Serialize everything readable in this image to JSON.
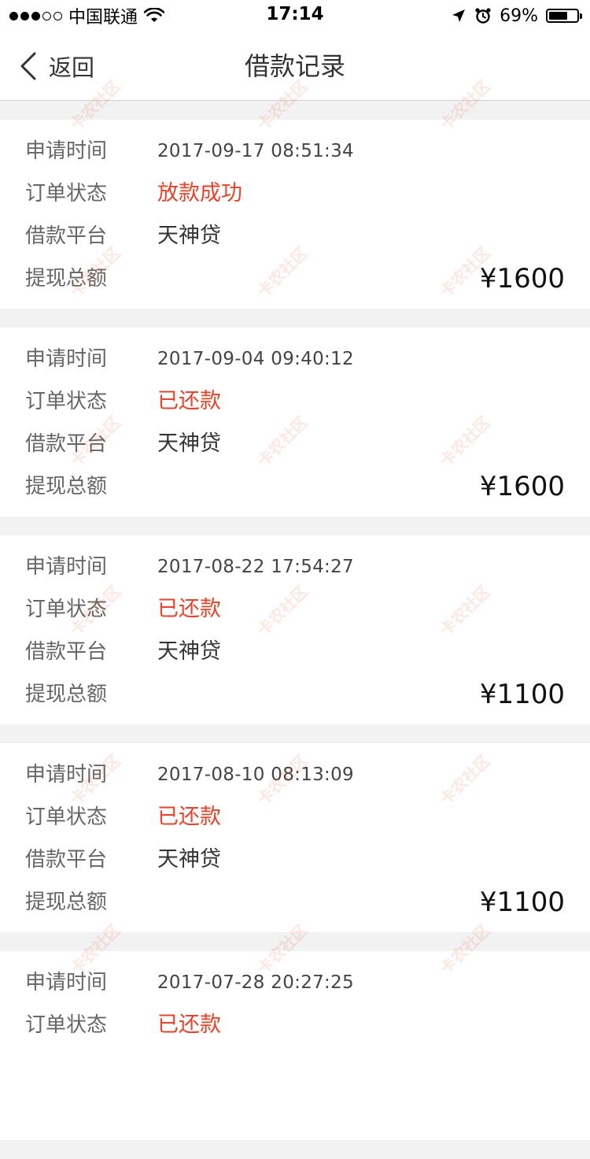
{
  "status_bar": {
    "carrier": "中国联通",
    "time": "17:14",
    "battery_percent": "69%",
    "battery_level": 0.69,
    "signal_filled": 3,
    "signal_total": 5
  },
  "nav": {
    "back_label": "返回",
    "title": "借款记录"
  },
  "labels": {
    "apply_time": "申请时间",
    "order_status": "订单状态",
    "platform": "借款平台",
    "amount": "提现总额"
  },
  "records": [
    {
      "apply_time": "2017-09-17 08:51:34",
      "status": "放款成功",
      "platform": "天神贷",
      "amount": "¥1600"
    },
    {
      "apply_time": "2017-09-04 09:40:12",
      "status": "已还款",
      "platform": "天神贷",
      "amount": "¥1600"
    },
    {
      "apply_time": "2017-08-22 17:54:27",
      "status": "已还款",
      "platform": "天神贷",
      "amount": "¥1100"
    },
    {
      "apply_time": "2017-08-10 08:13:09",
      "status": "已还款",
      "platform": "天神贷",
      "amount": "¥1100"
    },
    {
      "apply_time": "2017-07-28 20:27:25",
      "status": "已还款",
      "platform": "",
      "amount": ""
    }
  ],
  "watermark_text": "卡农社区",
  "colors": {
    "status_red": "#e8432a",
    "background": "#f2f2f2"
  }
}
